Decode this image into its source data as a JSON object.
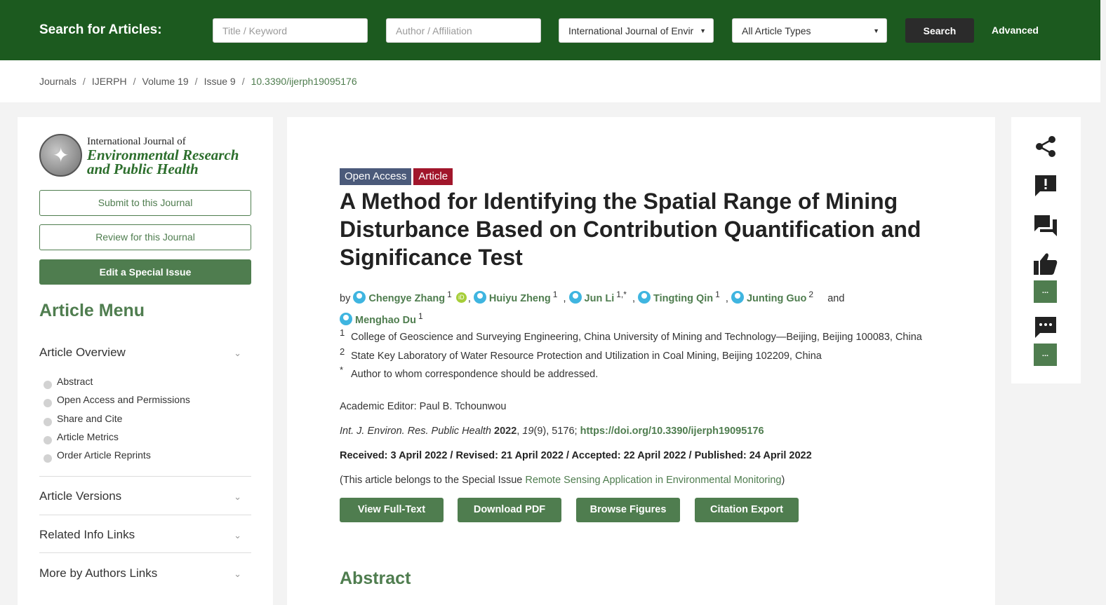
{
  "search": {
    "label": "Search for Articles:",
    "title_placeholder": "Title / Keyword",
    "author_placeholder": "Author / Affiliation",
    "journal_selected": "International Journal of Envir",
    "type_selected": "All Article Types",
    "search_button": "Search",
    "advanced_link": "Advanced"
  },
  "breadcrumb": {
    "items": [
      "Journals",
      "IJERPH",
      "Volume 19",
      "Issue 9"
    ],
    "current": "10.3390/ijerph19095176",
    "separator": "/"
  },
  "journal_logo": {
    "line1": "International Journal of",
    "line2": "Environmental Research",
    "line3": "and Public Health"
  },
  "sidebar": {
    "submit_button": "Submit to this Journal",
    "review_button": "Review for this Journal",
    "special_issue_button": "Edit a Special Issue",
    "menu_title": "Article Menu",
    "sections": {
      "overview": "Article Overview",
      "versions": "Article Versions",
      "related": "Related Info Links",
      "more_by_authors": "More by Authors Links"
    },
    "overview_items": [
      "Abstract",
      "Open Access and Permissions",
      "Share and Cite",
      "Article Metrics",
      "Order Article Reprints"
    ]
  },
  "article": {
    "badges": {
      "open_access": "Open Access",
      "type": "Article"
    },
    "title": "A Method for Identifying the Spatial Range of Mining Disturbance Based on Contribution Quantification and Significance Test",
    "by": "by",
    "and": "and",
    "authors": [
      {
        "name": "Chengye Zhang",
        "aff": "1"
      },
      {
        "name": "Huiyu Zheng",
        "aff": "1"
      },
      {
        "name": "Jun Li",
        "aff": "1,*"
      },
      {
        "name": "Tingting Qin",
        "aff": "1"
      },
      {
        "name": "Junting Guo",
        "aff": "2"
      },
      {
        "name": "Menghao Du",
        "aff": "1"
      }
    ],
    "affiliations": [
      {
        "mark": "1",
        "text": "College of Geoscience and Surveying Engineering, China University of Mining and Technology—Beijing, Beijing 100083, China"
      },
      {
        "mark": "2",
        "text": "State Key Laboratory of Water Resource Protection and Utilization in Coal Mining, Beijing 102209, China"
      },
      {
        "mark": "*",
        "text": "Author to whom correspondence should be addressed."
      }
    ],
    "academic_editor": "Academic Editor: Paul B. Tchounwou",
    "citation": {
      "journal": "Int. J. Environ. Res. Public Health",
      "year": "2022",
      "volume": "19",
      "issue_pages": "(9), 5176; ",
      "doi_link": "https://doi.org/10.3390/ijerph19095176"
    },
    "dates": "Received: 3 April 2022 / Revised: 21 April 2022 / Accepted: 22 April 2022 / Published: 24 April 2022",
    "special_issue": {
      "prefix": "(This article belongs to the Special Issue ",
      "link": "Remote Sensing Application in Environmental Monitoring",
      "suffix": ")"
    },
    "actions": [
      "View Full-Text",
      "Download PDF",
      "Browse Figures",
      "Citation Export"
    ],
    "abstract_heading": "Abstract"
  },
  "right_rail": {
    "icons": [
      "share-icon",
      "report-icon",
      "comments-icon",
      "thumbs-up-icon",
      "chat-icon"
    ],
    "badge_text": "..."
  },
  "colors": {
    "header_green": "#1c5a1f",
    "accent_green": "#4f7d4f",
    "open_access_badge": "#4b5a7a",
    "article_badge": "#a1162b"
  }
}
